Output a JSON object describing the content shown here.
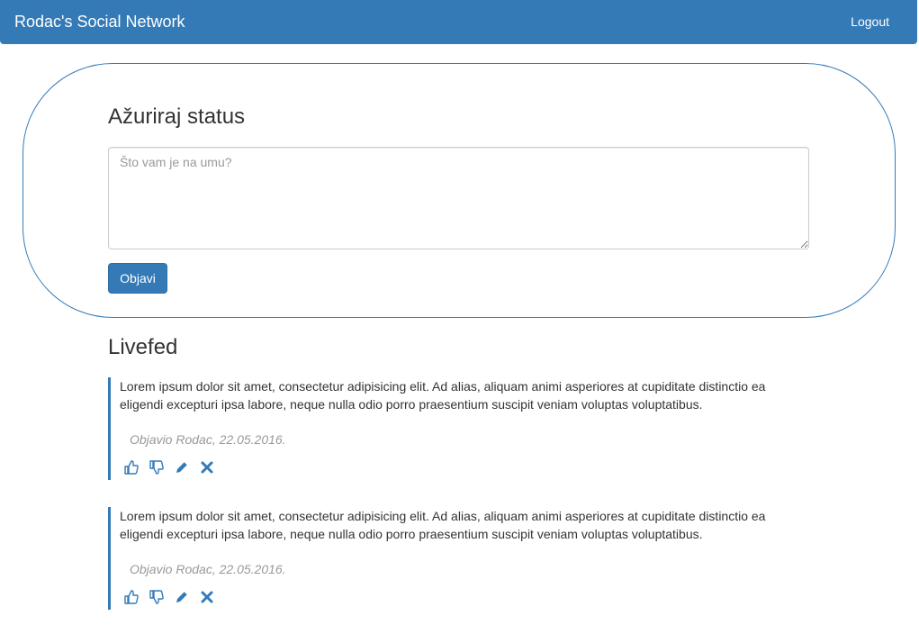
{
  "navbar": {
    "brand": "Rodac's Social Network",
    "logout_label": "Logout"
  },
  "status": {
    "title": "Ažuriraj status",
    "placeholder": "Što vam je na umu?",
    "value": "",
    "publish_label": "Objavi"
  },
  "feed": {
    "title": "Livefed",
    "posts": [
      {
        "text": "Lorem ipsum dolor sit amet, consectetur adipisicing elit. Ad alias, aliquam animi asperiores at cupiditate distinctio ea eligendi excepturi ipsa labore, neque nulla odio porro praesentium suscipit veniam voluptas voluptatibus.",
        "meta": "Objavio Rodac, 22.05.2016."
      },
      {
        "text": "Lorem ipsum dolor sit amet, consectetur adipisicing elit. Ad alias, aliquam animi asperiores at cupiditate distinctio ea eligendi excepturi ipsa labore, neque nulla odio porro praesentium suscipit veniam voluptas voluptatibus.",
        "meta": "Objavio Rodac, 22.05.2016."
      }
    ],
    "action_icons": [
      "thumbs-up-icon",
      "thumbs-down-icon",
      "pencil-icon",
      "remove-icon"
    ]
  },
  "colors": {
    "brand_blue": "#337ab7",
    "muted_text": "#999999"
  }
}
